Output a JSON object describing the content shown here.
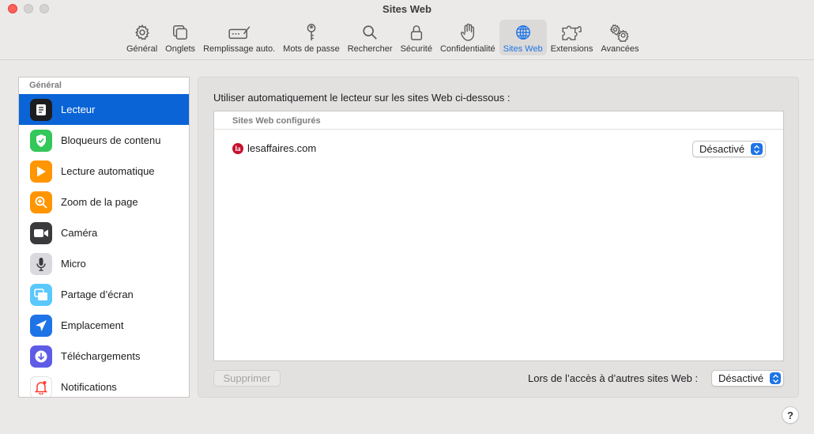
{
  "window": {
    "title": "Sites Web"
  },
  "toolbar": {
    "tabs": [
      {
        "label": "Général",
        "icon": "gear-icon"
      },
      {
        "label": "Onglets",
        "icon": "tabs-icon"
      },
      {
        "label": "Remplissage auto.",
        "icon": "autofill-icon"
      },
      {
        "label": "Mots de passe",
        "icon": "key-icon"
      },
      {
        "label": "Rechercher",
        "icon": "search-icon"
      },
      {
        "label": "Sécurité",
        "icon": "lock-icon"
      },
      {
        "label": "Confidentialité",
        "icon": "hand-icon"
      },
      {
        "label": "Sites Web",
        "icon": "globe-icon",
        "active": true
      },
      {
        "label": "Extensions",
        "icon": "puzzle-icon"
      },
      {
        "label": "Avancées",
        "icon": "gears-icon"
      }
    ]
  },
  "sidebar": {
    "header": "Général",
    "items": [
      {
        "label": "Lecteur",
        "icon": "reader-icon",
        "color": "#1d1d1f",
        "selected": true
      },
      {
        "label": "Bloqueurs de contenu",
        "icon": "shield-check-icon",
        "color": "#34c759"
      },
      {
        "label": "Lecture automatique",
        "icon": "play-icon",
        "color": "#ff9500"
      },
      {
        "label": "Zoom de la page",
        "icon": "zoom-icon",
        "color": "#ff9500"
      },
      {
        "label": "Caméra",
        "icon": "camera-icon",
        "color": "#3a3a3c"
      },
      {
        "label": "Micro",
        "icon": "microphone-icon",
        "color": "#d1d1d6"
      },
      {
        "label": "Partage d’écran",
        "icon": "screen-share-icon",
        "color": "#5ac8fa"
      },
      {
        "label": "Emplacement",
        "icon": "location-icon",
        "color": "#1e74e6"
      },
      {
        "label": "Téléchargements",
        "icon": "download-icon",
        "color": "#5e5ce6"
      },
      {
        "label": "Notifications",
        "icon": "bell-icon",
        "color": "#ff3b30"
      }
    ]
  },
  "main": {
    "intro": "Utiliser automatiquement le lecteur sur les sites Web ci-dessous :",
    "table_header": "Sites Web configurés",
    "rows": [
      {
        "favicon": "la",
        "site": "lesaffaires.com",
        "value": "Désactivé"
      }
    ],
    "delete_label": "Supprimer",
    "other_label": "Lors de l’accès à d’autres sites Web :",
    "other_value": "Désactivé"
  },
  "help": "?"
}
